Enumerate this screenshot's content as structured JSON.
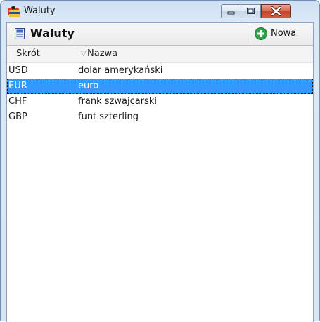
{
  "window": {
    "title": "Waluty",
    "controls": {
      "minimize_icon": "minimize-icon",
      "maximize_icon": "maximize-icon",
      "close_icon": "close-icon"
    }
  },
  "panel": {
    "title": "Waluty",
    "icon": "currency-list-icon",
    "new_button": {
      "label": "Nowa",
      "icon": "plus-circle-icon"
    }
  },
  "table": {
    "columns": [
      {
        "label": "Skrót"
      },
      {
        "label": "Nazwa",
        "sort": "descending"
      }
    ],
    "rows": [
      {
        "code": "USD",
        "name": "dolar amerykański",
        "selected": false
      },
      {
        "code": "EUR",
        "name": "euro",
        "selected": true
      },
      {
        "code": "CHF",
        "name": "frank szwajcarski",
        "selected": false
      },
      {
        "code": "GBP",
        "name": "funt szterling",
        "selected": false
      }
    ]
  },
  "colors": {
    "selection": "#3399ff",
    "close_button": "#c7422a",
    "add_icon": "#2fa24a"
  }
}
